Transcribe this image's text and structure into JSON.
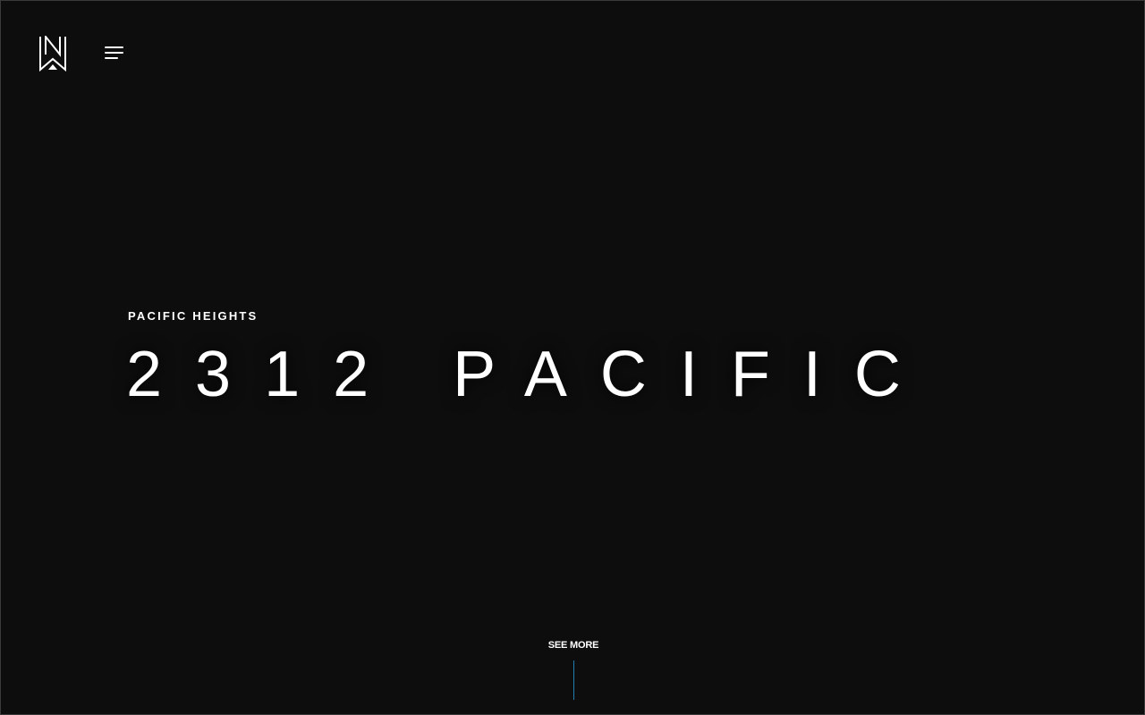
{
  "header": {
    "logo_icon": "nw-monogram-logo",
    "menu_icon": "hamburger-menu-icon"
  },
  "hero": {
    "subtitle": "PACIFIC HEIGHTS",
    "title": "2312 PACIFIC"
  },
  "footer": {
    "see_more_label": "SEE MORE",
    "accent_color": "#1f7fb3"
  },
  "colors": {
    "background": "#0d0d0d",
    "text": "#ffffff"
  }
}
